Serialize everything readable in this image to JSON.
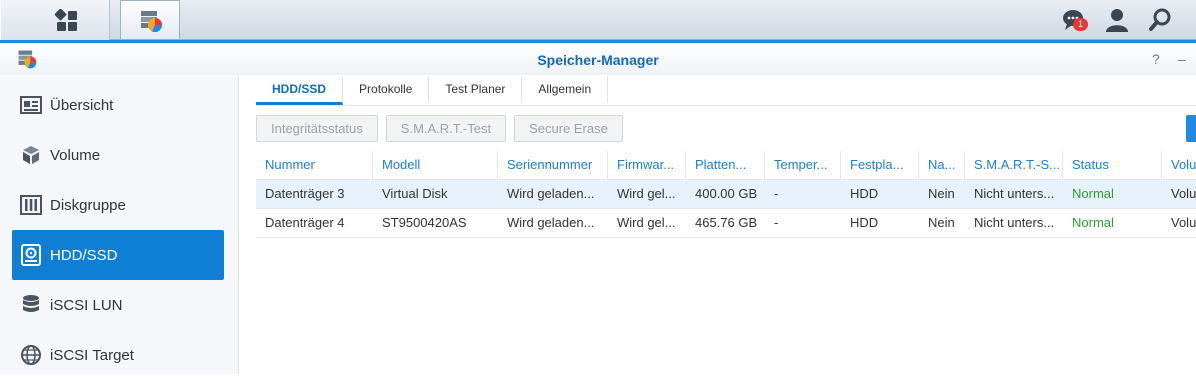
{
  "taskbar": {
    "main_menu_icon": "grid-icon",
    "app_icon": "storage-manager-icon",
    "notification_count": "1",
    "notification_icon": "chat-icon",
    "user_icon": "user-icon",
    "search_icon": "search-icon"
  },
  "window": {
    "title": "Speicher-Manager",
    "help_label": "?",
    "minimize_label": "–"
  },
  "sidebar": {
    "items": [
      {
        "label": "Übersicht",
        "icon": "overview-icon"
      },
      {
        "label": "Volume",
        "icon": "volume-icon"
      },
      {
        "label": "Diskgruppe",
        "icon": "diskgroup-icon"
      },
      {
        "label": "HDD/SSD",
        "icon": "hdd-icon",
        "active": true
      },
      {
        "label": "iSCSI LUN",
        "icon": "database-icon"
      },
      {
        "label": "iSCSI Target",
        "icon": "globe-icon"
      }
    ]
  },
  "tabs": [
    "HDD/SSD",
    "Protokolle",
    "Test Planer",
    "Allgemein"
  ],
  "toolbar": {
    "integrity_label": "Integritätsstatus",
    "smart_label": "S.M.A.R.T.-Test",
    "erase_label": "Secure Erase"
  },
  "table": {
    "columns": [
      "Nummer",
      "Modell",
      "Seriennummer",
      "Firmwar...",
      "Platten...",
      "Temper...",
      "Festpla...",
      "Na...",
      "S.M.A.R.T.-S...",
      "Status",
      "Volu"
    ],
    "rows": [
      [
        "Datenträger 3",
        "Virtual Disk",
        "Wird geladen...",
        "Wird gel...",
        "400.00 GB",
        "-",
        "HDD",
        "Nein",
        "Nicht unters...",
        "Normal",
        "Volu"
      ],
      [
        "Datenträger 4",
        "ST9500420AS",
        "Wird geladen...",
        "Wird gel...",
        "465.76 GB",
        "-",
        "HDD",
        "Nein",
        "Nicht unters...",
        "Normal",
        "Volu"
      ]
    ]
  },
  "colors": {
    "accent": "#0f7fd5",
    "status_ok": "#2ca02c",
    "header_text": "#1b7fd0",
    "badge": "#e53935"
  }
}
